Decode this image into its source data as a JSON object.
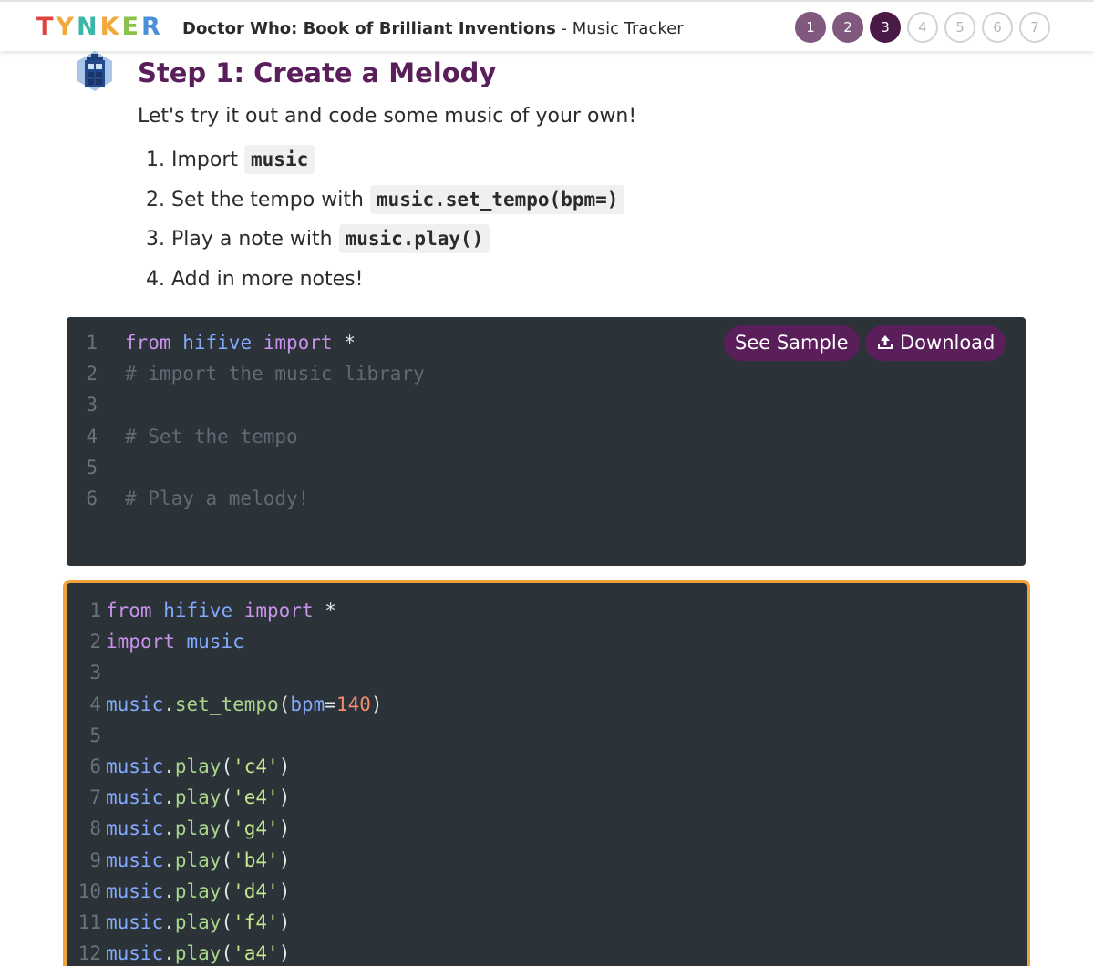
{
  "header": {
    "logo_letters": [
      "T",
      "Y",
      "N",
      "K",
      "E",
      "R"
    ],
    "logo_colors": [
      "#e0423e",
      "#f2a93b",
      "#3bb6a8",
      "#f2a93b",
      "#8bc34a",
      "#4a90d9"
    ],
    "course_title": "Doctor Who: Book of Brilliant Inventions",
    "separator": " - ",
    "lesson_name": "Music Tracker",
    "steps": [
      {
        "label": "1",
        "state": "done"
      },
      {
        "label": "2",
        "state": "done"
      },
      {
        "label": "3",
        "state": "current"
      },
      {
        "label": "4",
        "state": "todo"
      },
      {
        "label": "5",
        "state": "todo"
      },
      {
        "label": "6",
        "state": "todo"
      },
      {
        "label": "7",
        "state": "todo"
      }
    ]
  },
  "content": {
    "heading": "Step 1: Create a Melody",
    "intro": "Let's try it out and code some music of your own!",
    "instructions": [
      {
        "number": "1.",
        "text": "Import ",
        "code": "music"
      },
      {
        "number": "2.",
        "text": "Set the tempo with ",
        "code": "music.set_tempo(bpm=)"
      },
      {
        "number": "3.",
        "text": "Play a note with ",
        "code": "music.play()"
      },
      {
        "number": "4.",
        "text": "Add in more notes!",
        "code": ""
      }
    ]
  },
  "starter_code": {
    "buttons": {
      "see_sample": "See Sample",
      "download": "Download"
    },
    "lines": [
      {
        "n": "1",
        "tokens": [
          [
            "kw",
            "from"
          ],
          [
            "plain",
            " "
          ],
          [
            "mod",
            "hifive"
          ],
          [
            "plain",
            " "
          ],
          [
            "kw",
            "import"
          ],
          [
            "plain",
            " *"
          ]
        ]
      },
      {
        "n": "2",
        "tokens": [
          [
            "comment",
            "# import the music library"
          ]
        ]
      },
      {
        "n": "3",
        "tokens": []
      },
      {
        "n": "4",
        "tokens": [
          [
            "comment",
            "# Set the tempo"
          ]
        ]
      },
      {
        "n": "5",
        "tokens": []
      },
      {
        "n": "6",
        "tokens": [
          [
            "comment",
            "# Play a melody!"
          ]
        ]
      }
    ]
  },
  "editor_code": {
    "lines": [
      {
        "n": "1",
        "tokens": [
          [
            "kw",
            "from"
          ],
          [
            "plain",
            " "
          ],
          [
            "mod",
            "hifive"
          ],
          [
            "plain",
            " "
          ],
          [
            "kw",
            "import"
          ],
          [
            "plain",
            " *"
          ]
        ]
      },
      {
        "n": "2",
        "tokens": [
          [
            "kw",
            "import"
          ],
          [
            "plain",
            " "
          ],
          [
            "mod",
            "music"
          ]
        ]
      },
      {
        "n": "3",
        "tokens": []
      },
      {
        "n": "4",
        "tokens": [
          [
            "mod",
            "music"
          ],
          [
            "plain",
            "."
          ],
          [
            "fn",
            "set_tempo"
          ],
          [
            "plain",
            "("
          ],
          [
            "attr",
            "bpm"
          ],
          [
            "plain",
            "="
          ],
          [
            "num",
            "140"
          ],
          [
            "plain",
            ")"
          ]
        ]
      },
      {
        "n": "5",
        "tokens": []
      },
      {
        "n": "6",
        "tokens": [
          [
            "mod",
            "music"
          ],
          [
            "plain",
            "."
          ],
          [
            "fn",
            "play"
          ],
          [
            "plain",
            "("
          ],
          [
            "str",
            "'c4'"
          ],
          [
            "plain",
            ")"
          ]
        ]
      },
      {
        "n": "7",
        "tokens": [
          [
            "mod",
            "music"
          ],
          [
            "plain",
            "."
          ],
          [
            "fn",
            "play"
          ],
          [
            "plain",
            "("
          ],
          [
            "str",
            "'e4'"
          ],
          [
            "plain",
            ")"
          ]
        ]
      },
      {
        "n": "8",
        "tokens": [
          [
            "mod",
            "music"
          ],
          [
            "plain",
            "."
          ],
          [
            "fn",
            "play"
          ],
          [
            "plain",
            "("
          ],
          [
            "str",
            "'g4'"
          ],
          [
            "plain",
            ")"
          ]
        ]
      },
      {
        "n": "9",
        "tokens": [
          [
            "mod",
            "music"
          ],
          [
            "plain",
            "."
          ],
          [
            "fn",
            "play"
          ],
          [
            "plain",
            "("
          ],
          [
            "str",
            "'b4'"
          ],
          [
            "plain",
            ")"
          ]
        ]
      },
      {
        "n": "10",
        "tokens": [
          [
            "mod",
            "music"
          ],
          [
            "plain",
            "."
          ],
          [
            "fn",
            "play"
          ],
          [
            "plain",
            "("
          ],
          [
            "str",
            "'d4'"
          ],
          [
            "plain",
            ")"
          ]
        ]
      },
      {
        "n": "11",
        "tokens": [
          [
            "mod",
            "music"
          ],
          [
            "plain",
            "."
          ],
          [
            "fn",
            "play"
          ],
          [
            "plain",
            "("
          ],
          [
            "str",
            "'f4'"
          ],
          [
            "plain",
            ")"
          ]
        ]
      },
      {
        "n": "12",
        "tokens": [
          [
            "mod",
            "music"
          ],
          [
            "plain",
            "."
          ],
          [
            "fn",
            "play"
          ],
          [
            "plain",
            "("
          ],
          [
            "str",
            "'a4'"
          ],
          [
            "plain",
            ")"
          ]
        ]
      }
    ]
  }
}
